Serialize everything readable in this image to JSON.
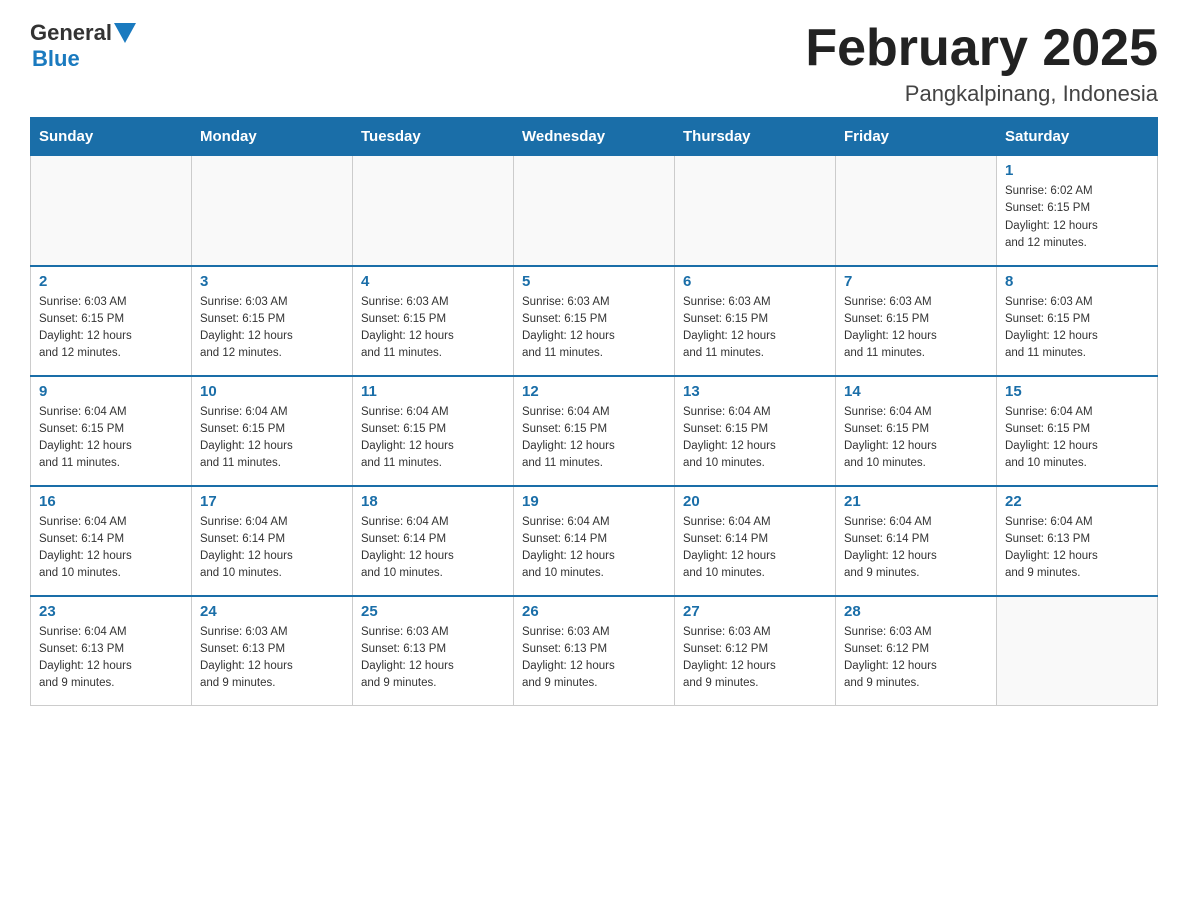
{
  "header": {
    "title": "February 2025",
    "subtitle": "Pangkalpinang, Indonesia",
    "logo_general": "General",
    "logo_blue": "Blue"
  },
  "days_of_week": [
    "Sunday",
    "Monday",
    "Tuesday",
    "Wednesday",
    "Thursday",
    "Friday",
    "Saturday"
  ],
  "weeks": [
    [
      {
        "day": "",
        "info": ""
      },
      {
        "day": "",
        "info": ""
      },
      {
        "day": "",
        "info": ""
      },
      {
        "day": "",
        "info": ""
      },
      {
        "day": "",
        "info": ""
      },
      {
        "day": "",
        "info": ""
      },
      {
        "day": "1",
        "info": "Sunrise: 6:02 AM\nSunset: 6:15 PM\nDaylight: 12 hours\nand 12 minutes."
      }
    ],
    [
      {
        "day": "2",
        "info": "Sunrise: 6:03 AM\nSunset: 6:15 PM\nDaylight: 12 hours\nand 12 minutes."
      },
      {
        "day": "3",
        "info": "Sunrise: 6:03 AM\nSunset: 6:15 PM\nDaylight: 12 hours\nand 12 minutes."
      },
      {
        "day": "4",
        "info": "Sunrise: 6:03 AM\nSunset: 6:15 PM\nDaylight: 12 hours\nand 11 minutes."
      },
      {
        "day": "5",
        "info": "Sunrise: 6:03 AM\nSunset: 6:15 PM\nDaylight: 12 hours\nand 11 minutes."
      },
      {
        "day": "6",
        "info": "Sunrise: 6:03 AM\nSunset: 6:15 PM\nDaylight: 12 hours\nand 11 minutes."
      },
      {
        "day": "7",
        "info": "Sunrise: 6:03 AM\nSunset: 6:15 PM\nDaylight: 12 hours\nand 11 minutes."
      },
      {
        "day": "8",
        "info": "Sunrise: 6:03 AM\nSunset: 6:15 PM\nDaylight: 12 hours\nand 11 minutes."
      }
    ],
    [
      {
        "day": "9",
        "info": "Sunrise: 6:04 AM\nSunset: 6:15 PM\nDaylight: 12 hours\nand 11 minutes."
      },
      {
        "day": "10",
        "info": "Sunrise: 6:04 AM\nSunset: 6:15 PM\nDaylight: 12 hours\nand 11 minutes."
      },
      {
        "day": "11",
        "info": "Sunrise: 6:04 AM\nSunset: 6:15 PM\nDaylight: 12 hours\nand 11 minutes."
      },
      {
        "day": "12",
        "info": "Sunrise: 6:04 AM\nSunset: 6:15 PM\nDaylight: 12 hours\nand 11 minutes."
      },
      {
        "day": "13",
        "info": "Sunrise: 6:04 AM\nSunset: 6:15 PM\nDaylight: 12 hours\nand 10 minutes."
      },
      {
        "day": "14",
        "info": "Sunrise: 6:04 AM\nSunset: 6:15 PM\nDaylight: 12 hours\nand 10 minutes."
      },
      {
        "day": "15",
        "info": "Sunrise: 6:04 AM\nSunset: 6:15 PM\nDaylight: 12 hours\nand 10 minutes."
      }
    ],
    [
      {
        "day": "16",
        "info": "Sunrise: 6:04 AM\nSunset: 6:14 PM\nDaylight: 12 hours\nand 10 minutes."
      },
      {
        "day": "17",
        "info": "Sunrise: 6:04 AM\nSunset: 6:14 PM\nDaylight: 12 hours\nand 10 minutes."
      },
      {
        "day": "18",
        "info": "Sunrise: 6:04 AM\nSunset: 6:14 PM\nDaylight: 12 hours\nand 10 minutes."
      },
      {
        "day": "19",
        "info": "Sunrise: 6:04 AM\nSunset: 6:14 PM\nDaylight: 12 hours\nand 10 minutes."
      },
      {
        "day": "20",
        "info": "Sunrise: 6:04 AM\nSunset: 6:14 PM\nDaylight: 12 hours\nand 10 minutes."
      },
      {
        "day": "21",
        "info": "Sunrise: 6:04 AM\nSunset: 6:14 PM\nDaylight: 12 hours\nand 9 minutes."
      },
      {
        "day": "22",
        "info": "Sunrise: 6:04 AM\nSunset: 6:13 PM\nDaylight: 12 hours\nand 9 minutes."
      }
    ],
    [
      {
        "day": "23",
        "info": "Sunrise: 6:04 AM\nSunset: 6:13 PM\nDaylight: 12 hours\nand 9 minutes."
      },
      {
        "day": "24",
        "info": "Sunrise: 6:03 AM\nSunset: 6:13 PM\nDaylight: 12 hours\nand 9 minutes."
      },
      {
        "day": "25",
        "info": "Sunrise: 6:03 AM\nSunset: 6:13 PM\nDaylight: 12 hours\nand 9 minutes."
      },
      {
        "day": "26",
        "info": "Sunrise: 6:03 AM\nSunset: 6:13 PM\nDaylight: 12 hours\nand 9 minutes."
      },
      {
        "day": "27",
        "info": "Sunrise: 6:03 AM\nSunset: 6:12 PM\nDaylight: 12 hours\nand 9 minutes."
      },
      {
        "day": "28",
        "info": "Sunrise: 6:03 AM\nSunset: 6:12 PM\nDaylight: 12 hours\nand 9 minutes."
      },
      {
        "day": "",
        "info": ""
      }
    ]
  ]
}
